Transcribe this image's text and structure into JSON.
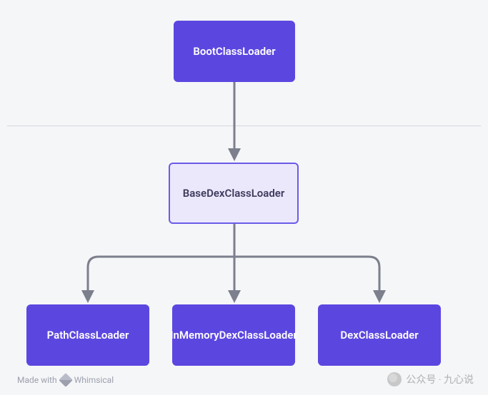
{
  "chart_data": {
    "type": "diagram",
    "title": "",
    "nodes": [
      {
        "id": "BootClassLoader",
        "label": "BootClassLoader",
        "style": "solid",
        "level": 0
      },
      {
        "id": "BaseDexClassLoader",
        "label": "BaseDexClassLoader",
        "style": "outline",
        "level": 1
      },
      {
        "id": "PathClassLoader",
        "label": "PathClassLoader",
        "style": "solid",
        "level": 2
      },
      {
        "id": "InMemoryDexClassLoader",
        "label": "InMemoryDexClassLoader",
        "style": "solid",
        "level": 2
      },
      {
        "id": "DexClassLoader",
        "label": "DexClassLoader",
        "style": "solid",
        "level": 2
      }
    ],
    "edges": [
      {
        "from": "BootClassLoader",
        "to": "BaseDexClassLoader"
      },
      {
        "from": "BaseDexClassLoader",
        "to": "PathClassLoader"
      },
      {
        "from": "BaseDexClassLoader",
        "to": "InMemoryDexClassLoader"
      },
      {
        "from": "BaseDexClassLoader",
        "to": "DexClassLoader"
      }
    ]
  },
  "nodes": {
    "boot": "BootClassLoader",
    "base": "BaseDexClassLoader",
    "path": "PathClassLoader",
    "inmem": "InMemoryDexClassLoader",
    "dex": "DexClassLoader"
  },
  "colors": {
    "solid_bg": "#5b47e0",
    "outline_bg": "#ece8fc",
    "outline_border": "#6b5be8",
    "canvas_bg": "#f5f6f8",
    "arrow": "#7c7f8c"
  },
  "watermark": {
    "made_with": "Made with",
    "brand": "Whimsical",
    "right_text": "公众号 · 九心说"
  }
}
